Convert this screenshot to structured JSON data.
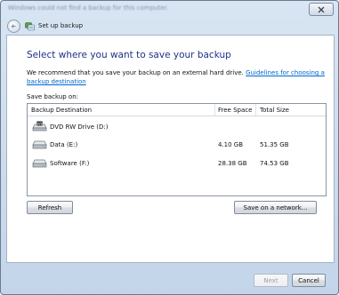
{
  "window": {
    "title": "Windows could not find a backup for this computer."
  },
  "navbar": {
    "title": "Set up backup"
  },
  "main": {
    "heading": "Select where you want to save your backup",
    "description": "We recommend that you save your backup on an external hard drive.",
    "guidelines_link": "Guidelines for choosing a backup destination",
    "save_label": "Save backup on:"
  },
  "table": {
    "columns": [
      "Backup Destination",
      "Free Space",
      "Total Size"
    ],
    "rows": [
      {
        "name": "DVD RW Drive (D:)",
        "free": "",
        "total": "",
        "icon": "dvd-drive-icon"
      },
      {
        "name": "Data (E:)",
        "free": "4.10 GB",
        "total": "51.35 GB",
        "icon": "hard-drive-icon"
      },
      {
        "name": "Software (F:)",
        "free": "28.38 GB",
        "total": "74.53 GB",
        "icon": "hard-drive-icon"
      }
    ]
  },
  "buttons": {
    "refresh": "Refresh",
    "save_network": "Save on a network...",
    "next": "Next",
    "cancel": "Cancel"
  },
  "icons": {
    "close": "close-icon",
    "back": "back-arrow-icon",
    "app": "backup-app-icon"
  }
}
